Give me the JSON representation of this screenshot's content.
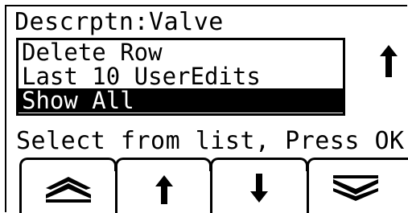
{
  "screen": {
    "title": "Descrptn:Valve",
    "list": {
      "items": [
        {
          "label": "Delete Row",
          "selected": false
        },
        {
          "label": "Last 10 UserEdits",
          "selected": false
        },
        {
          "label": "Show All",
          "selected": true
        }
      ]
    },
    "scroll_indicator_icon": "arrow-up-icon",
    "prompt": "Select from list, Press OK",
    "softkeys": [
      {
        "icon": "double-chevron-up-icon"
      },
      {
        "icon": "arrow-up-icon"
      },
      {
        "icon": "arrow-down-icon"
      },
      {
        "icon": "double-chevron-down-icon"
      }
    ],
    "colors": {
      "foreground": "#000000",
      "background": "#ffffff",
      "selection": "#000000"
    }
  }
}
